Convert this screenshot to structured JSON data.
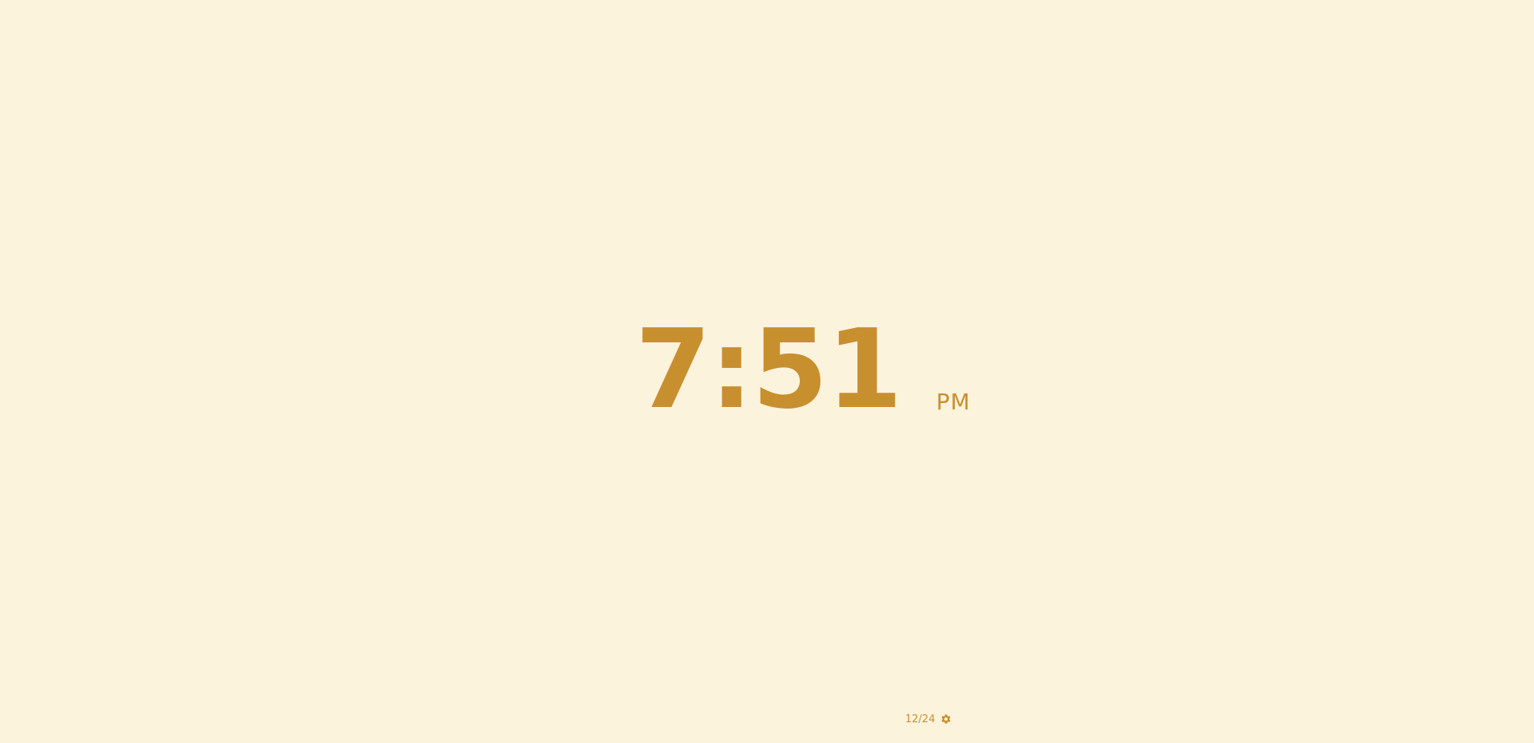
{
  "clock": {
    "time": "7:51",
    "period": "PM"
  },
  "footer": {
    "format_toggle": "12/24",
    "settings_icon": "gear-icon"
  },
  "colors": {
    "background": "#fcf3dd",
    "accent": "#c88f2f"
  }
}
